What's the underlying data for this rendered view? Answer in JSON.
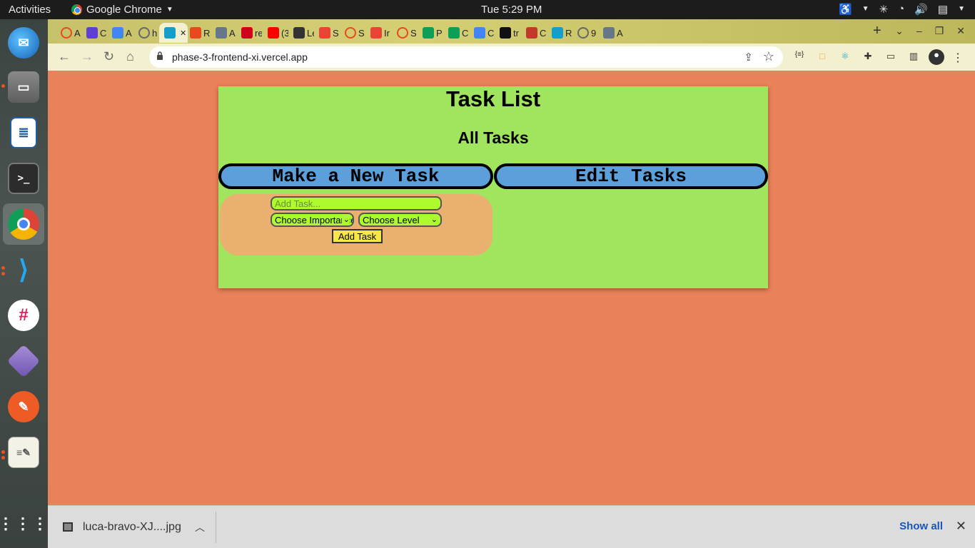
{
  "topbar": {
    "activities": "Activities",
    "app_name": "Google Chrome",
    "clock": "Tue   5:29 PM"
  },
  "dock": {
    "items": [
      "thunderbird",
      "files",
      "libreoffice-writer",
      "terminal",
      "chrome",
      "vscode",
      "slack",
      "dbeaver",
      "postman",
      "text-editor",
      "app-grid"
    ]
  },
  "tabs": [
    {
      "label": "A",
      "color": "#e8491d",
      "icon": "ring-icon"
    },
    {
      "label": "C",
      "color": "#5d3fd3",
      "icon": "list-icon"
    },
    {
      "label": "A",
      "color": "#4285f4",
      "icon": "docs-icon"
    },
    {
      "label": "h",
      "color": "#666666",
      "icon": "globe-icon"
    },
    {
      "label": "",
      "color": "#149eca",
      "icon": "react-icon",
      "active": true
    },
    {
      "label": "R",
      "color": "#e8491d",
      "icon": "flatiron-icon"
    },
    {
      "label": "A",
      "color": "#667788",
      "icon": "avatar-icon"
    },
    {
      "label": "re",
      "color": "#d0021b",
      "icon": "red-square-icon"
    },
    {
      "label": "(3",
      "color": "#ff0000",
      "icon": "youtube-icon"
    },
    {
      "label": "Le",
      "color": "#333333",
      "icon": "square-icon"
    },
    {
      "label": "S",
      "color": "#ea4335",
      "icon": "gmail-icon"
    },
    {
      "label": "S",
      "color": "#e8491d",
      "icon": "ring-icon"
    },
    {
      "label": "Ir",
      "color": "#ea4335",
      "icon": "gmail-icon"
    },
    {
      "label": "S",
      "color": "#e8491d",
      "icon": "ring-icon"
    },
    {
      "label": "P",
      "color": "#0f9d58",
      "icon": "plus-icon"
    },
    {
      "label": "C",
      "color": "#0f9d58",
      "icon": "plus-icon"
    },
    {
      "label": "C",
      "color": "#4285f4",
      "icon": "google-icon"
    },
    {
      "label": "tr",
      "color": "#111111",
      "icon": "tower-icon"
    },
    {
      "label": "C",
      "color": "#c0392b",
      "icon": "heart-icon"
    },
    {
      "label": "R",
      "color": "#149eca",
      "icon": "react-icon"
    },
    {
      "label": "9",
      "color": "#666666",
      "icon": "globe-icon"
    },
    {
      "label": "A",
      "color": "#667788",
      "icon": "avatar-icon"
    }
  ],
  "toolbar": {
    "url": "phase-3-frontend-xi.vercel.app"
  },
  "page": {
    "title": "Task List",
    "subtitle": "All Tasks",
    "new_task_button": "Make a New Task",
    "edit_tasks_button": "Edit Tasks",
    "form": {
      "task_placeholder": "Add Task...",
      "importance_select": "Choose Importance",
      "level_select": "Choose Level",
      "add_button": "Add Task"
    }
  },
  "downloads": {
    "file_name": "luca-bravo-XJ....jpg",
    "show_all": "Show all"
  },
  "colors": {
    "page_bg": "#e9825a",
    "card_bg": "#a1e55f",
    "button_blue": "#5c9fdb",
    "form_bg": "#e9b070",
    "input_bg": "#adfa2e",
    "add_button_bg": "#f6e745"
  }
}
